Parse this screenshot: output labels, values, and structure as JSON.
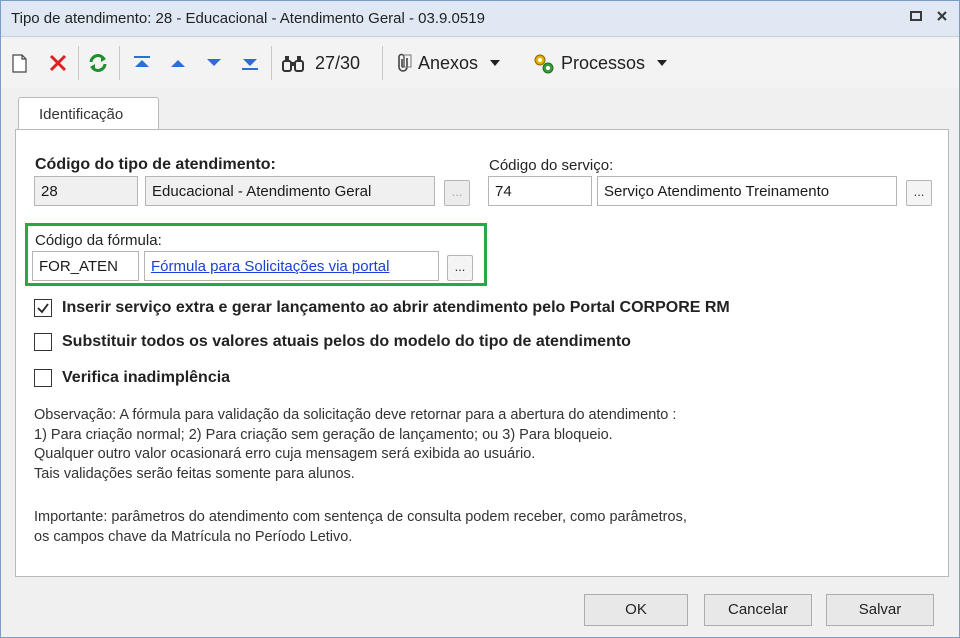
{
  "window": {
    "title": "Tipo de atendimento: 28 - Educacional - Atendimento Geral - 03.9.0519"
  },
  "toolbar": {
    "record_counter": "27/30",
    "attachments_label": "Anexos",
    "processes_label": "Processos"
  },
  "tabs": [
    {
      "label": "Identificação",
      "active": true
    }
  ],
  "form": {
    "tipo_atendimento_label": "Código do tipo de atendimento:",
    "tipo_atendimento_code": "28",
    "tipo_atendimento_desc": "Educacional - Atendimento Geral",
    "servico_label": "Código do serviço:",
    "servico_code": "74",
    "servico_desc": "Serviço Atendimento Treinamento",
    "formula_label": "Código da fórmula:",
    "formula_code": "FOR_ATEN",
    "formula_desc": "Fórmula para Solicitações via portal",
    "lookup_button": "..."
  },
  "checkboxes": [
    {
      "label": "Inserir serviço extra e gerar lançamento ao abrir atendimento pelo Portal CORPORE RM",
      "checked": true
    },
    {
      "label": "Substituir todos os valores atuais pelos do modelo do tipo de atendimento",
      "checked": false
    },
    {
      "label": "Verifica inadimplência",
      "checked": false
    }
  ],
  "observation": {
    "lines": [
      "Observação: A fórmula para validação da solicitação deve retornar para a abertura do atendimento :",
      "1) Para criação normal;  2) Para criação sem geração de lançamento;  ou 3) Para bloqueio.",
      "Qualquer outro valor ocasionará erro cuja mensagem será exibida ao usuário.",
      "Tais validações serão feitas somente para alunos."
    ],
    "important_lines": [
      "Importante: parâmetros do atendimento com sentença de consulta podem receber, como parâmetros,",
      "os campos chave da Matrícula no Período Letivo."
    ]
  },
  "footer": {
    "ok_label": "OK",
    "cancel_label": "Cancelar",
    "save_label": "Salvar"
  },
  "colors": {
    "highlight_border": "#29a647",
    "link": "#1a3fd6",
    "delete_red": "#e02020",
    "refresh_green": "#1e8f2e",
    "nav_blue": "#2b6fd6"
  }
}
